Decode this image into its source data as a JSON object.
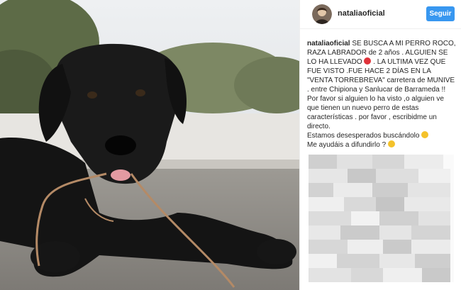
{
  "post": {
    "username": "nataliaoficial",
    "follow_button": "Seguir"
  },
  "caption": {
    "username": "nataliaoficial",
    "segments": [
      "SE BUSCA A MI PERRO ROCO, RAZA LABRADOR de 2 años . ALGUIEN SE LO HA LLEVADO",
      ". LA ULTIMA VEZ QUE FUE VISTO .FUE HACE 2 DÍAS EN LA \"VENTA TORREBREVA\" carretera de MUNIVE . entre Chipiona y Sanlucar de Barrameda !! Por favor si alguien lo ha visto ,o alguien ve que tienen un nuevo perro de estas características . por favor , escribidme un directo.",
      "Estamos desesperados buscándolo",
      "Me ayudáis a difundirlo ?"
    ],
    "emojis": [
      "red-angry-face-emoji",
      "sad-face-emoji",
      "sad-face-emoji"
    ]
  },
  "colors": {
    "follow_button": "#3897f0",
    "text": "#262626",
    "divider": "#efefef"
  },
  "icons": {
    "avatar": "profile-avatar"
  }
}
